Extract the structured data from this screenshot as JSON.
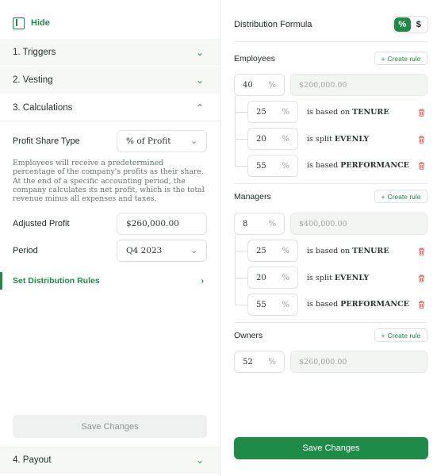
{
  "left": {
    "hide_label": "Hide",
    "sections": {
      "triggers": "1. Triggers",
      "vesting": "2. Vesting",
      "calculations": "3. Calculations",
      "payout": "4. Payout"
    },
    "profit_share_type": {
      "label": "Profit Share Type",
      "value": "% of Profit"
    },
    "description": "Employees will receive a predetermined percentage of the company's profits as their share. At the end of a specific accounting period, the company calculates its net profit, which is the total revenue minus all expenses and taxes.",
    "adjusted_profit": {
      "label": "Adjusted Profit",
      "value": "$260,000.00"
    },
    "period": {
      "label": "Period",
      "value": "Q4 2023"
    },
    "set_distribution_rules": "Set Distribution Rules",
    "save_label": "Save Changes"
  },
  "right": {
    "title": "Distribution Formula",
    "toggle": {
      "percent": "%",
      "dollar": "$",
      "active": "percent"
    },
    "create_rule_label": "Create rule",
    "employees": {
      "label": "Employees",
      "percent": "40",
      "amount": "$200,000.00",
      "rules": [
        {
          "percent": "25",
          "prefix": "is based on ",
          "keyword": "TENURE"
        },
        {
          "percent": "20",
          "prefix": "is split ",
          "keyword": "EVENLY"
        },
        {
          "percent": "55",
          "prefix": "is based ",
          "keyword": "PERFORMANCE"
        }
      ]
    },
    "managers": {
      "label": "Managers",
      "percent": "8",
      "amount": "$400,000.00",
      "rules": [
        {
          "percent": "25",
          "prefix": "is based on ",
          "keyword": "TENURE"
        },
        {
          "percent": "20",
          "prefix": "is split ",
          "keyword": "EVENLY"
        },
        {
          "percent": "55",
          "prefix": "is based ",
          "keyword": "PERFORMANCE"
        }
      ]
    },
    "owners": {
      "label": "Owners",
      "percent": "52",
      "amount": "$260,000.00"
    },
    "save_label": "Save Changes"
  },
  "colors": {
    "accent": "#1e8a46",
    "danger": "#d9534f"
  }
}
